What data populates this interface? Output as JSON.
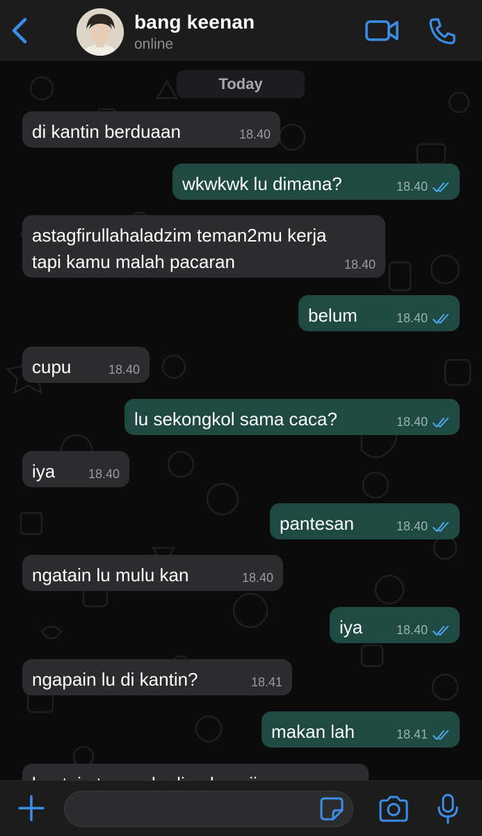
{
  "header": {
    "contact_name": "bang keenan",
    "status": "online",
    "back_icon": "chevron-left-icon",
    "video_icon": "video-camera-icon",
    "call_icon": "phone-icon",
    "accent_color": "#3b8eea"
  },
  "chat": {
    "date_label": "Today",
    "messages": [
      {
        "dir": "in",
        "text": "di kantin berduaan",
        "time": "18.40"
      },
      {
        "dir": "out",
        "text": "wkwkwk lu dimana?",
        "time": "18.40"
      },
      {
        "dir": "in",
        "text": "astagfirullahaladzim teman2mu kerja tapi kamu malah pacaran",
        "time": "18.40"
      },
      {
        "dir": "out",
        "text": "belum",
        "time": "18.40"
      },
      {
        "dir": "in",
        "text": "cupu",
        "time": "18.40"
      },
      {
        "dir": "out",
        "text": "lu sekongkol sama caca?",
        "time": "18.40"
      },
      {
        "dir": "in",
        "text": "iya",
        "time": "18.40"
      },
      {
        "dir": "out",
        "text": "pantesan",
        "time": "18.40"
      },
      {
        "dir": "in",
        "text": "ngatain lu mulu kan",
        "time": "18.40"
      },
      {
        "dir": "out",
        "text": "iya",
        "time": "18.40"
      },
      {
        "dir": "in",
        "text": "ngapain lu di kantin?",
        "time": "18.41"
      },
      {
        "dir": "out",
        "text": "makan lah",
        "time": "18.41"
      },
      {
        "dir": "in",
        "text": "bantuin temen lu di aula anjir",
        "time": ""
      }
    ],
    "incoming_color": "#2c2c2e",
    "outgoing_color": "#1e4a43",
    "read_tick_color": "#4fa8f0"
  },
  "composer": {
    "input_value": "",
    "plus_icon": "plus-icon",
    "sticker_icon": "sticker-icon",
    "camera_icon": "camera-icon",
    "mic_icon": "microphone-icon"
  }
}
